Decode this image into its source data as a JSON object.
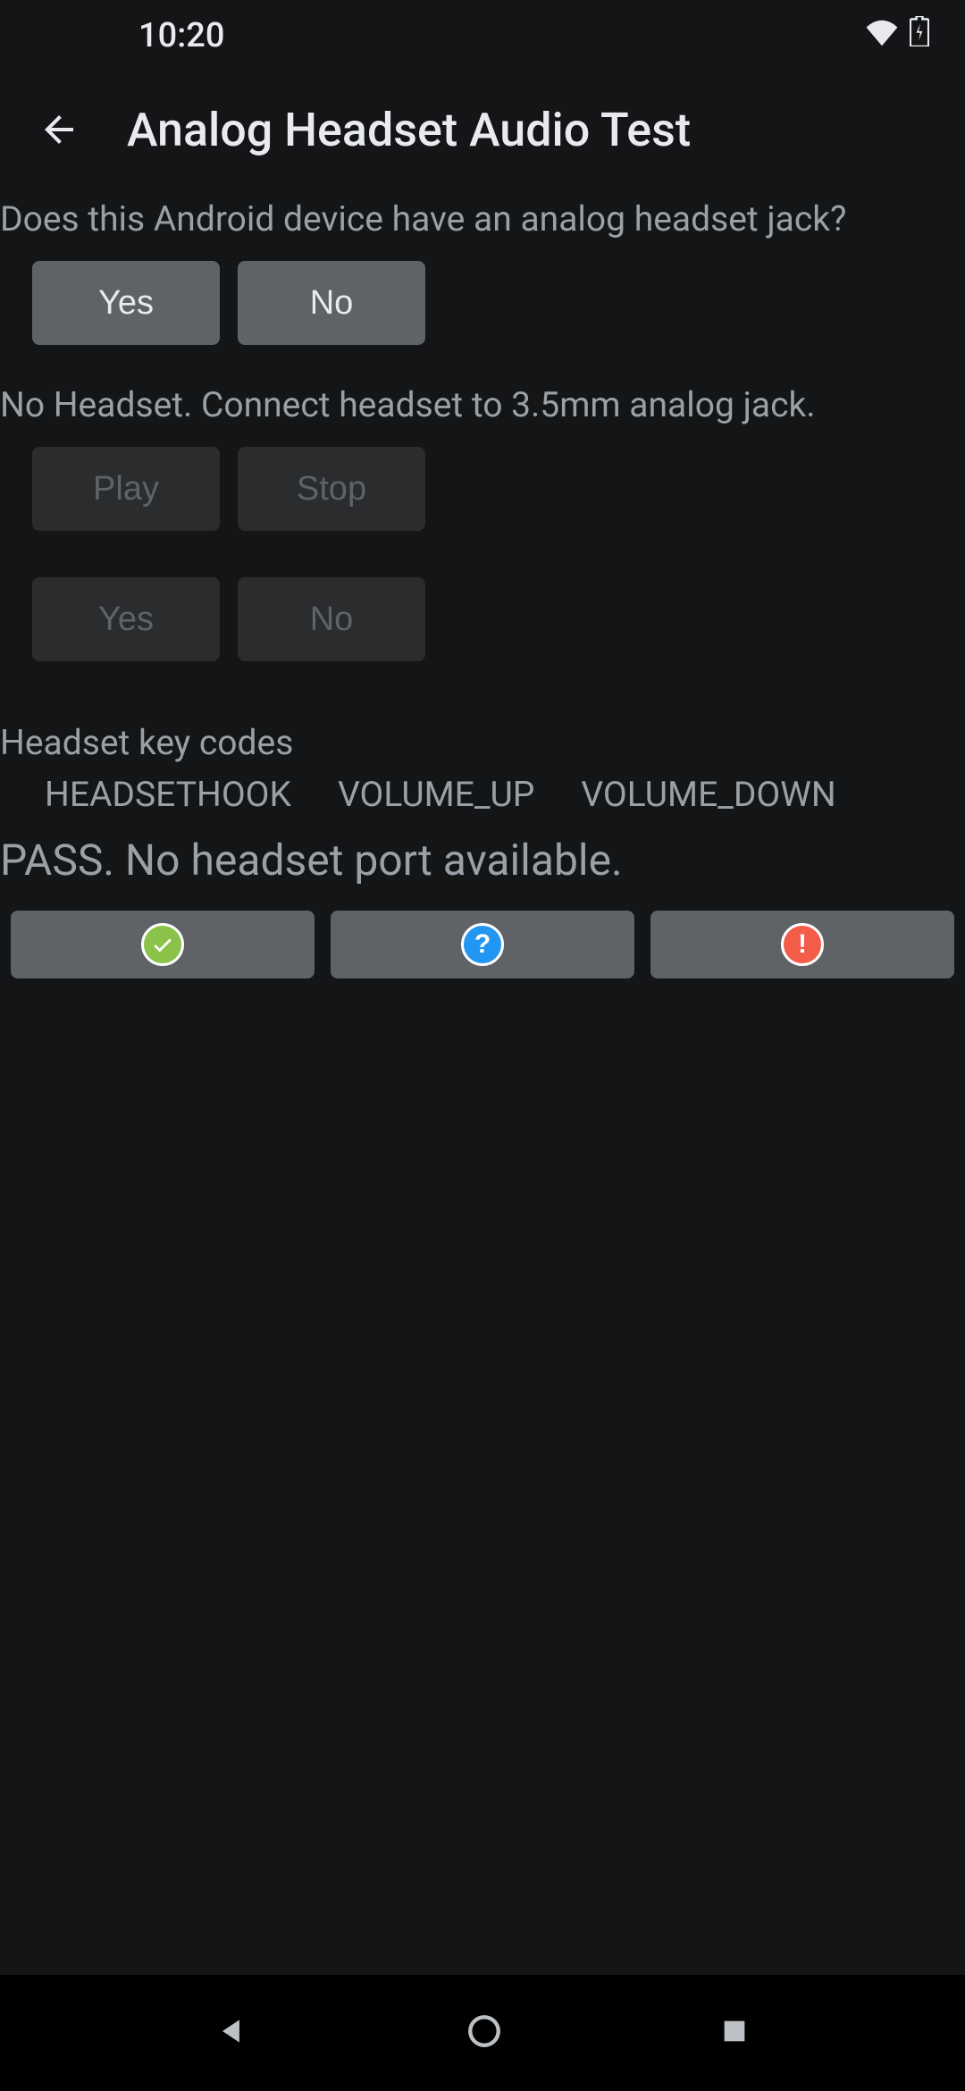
{
  "status_bar": {
    "time": "10:20"
  },
  "header": {
    "title": "Analog Headset Audio Test"
  },
  "question1": "Does this Android device have an analog headset jack?",
  "buttons1": {
    "yes": "Yes",
    "no": "No"
  },
  "status_msg": "No Headset. Connect headset to 3.5mm analog jack.",
  "playback": {
    "play": "Play",
    "stop": "Stop"
  },
  "buttons2": {
    "yes": "Yes",
    "no": "No"
  },
  "keycodes_label": "Headset key codes",
  "keycodes": [
    "HEADSETHOOK",
    "VOLUME_UP",
    "VOLUME_DOWN"
  ],
  "result": "PASS. No headset port available."
}
